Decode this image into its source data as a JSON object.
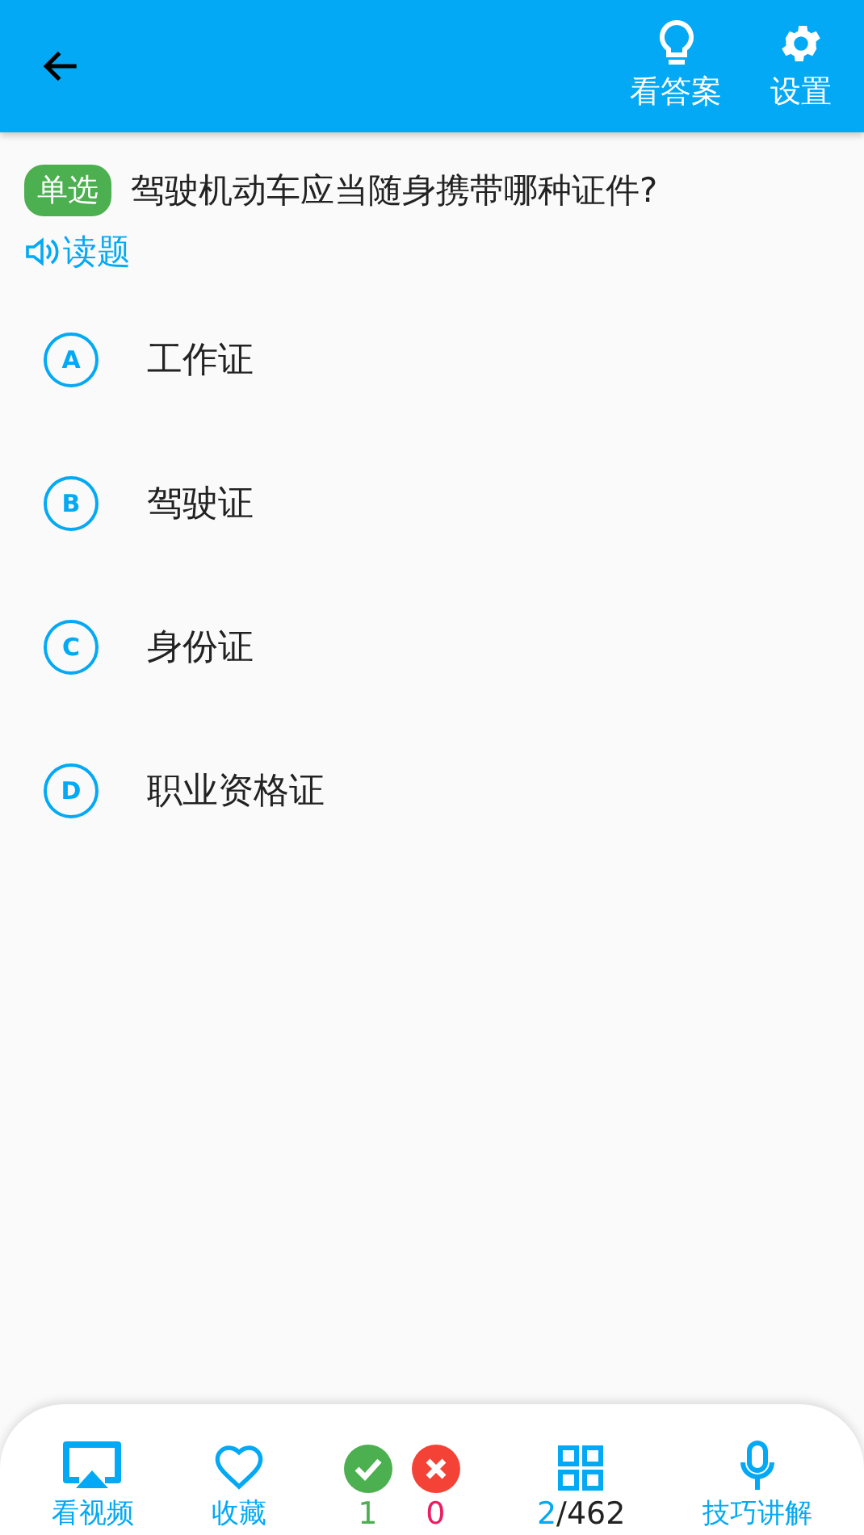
{
  "header": {
    "actions": [
      {
        "kind": "answer",
        "label": "看答案"
      },
      {
        "kind": "settings",
        "label": "设置"
      }
    ]
  },
  "question": {
    "type_badge": "单选",
    "text": "驾驶机动车应当随身携带哪种证件?",
    "read_label": "读题"
  },
  "options": [
    {
      "letter": "A",
      "text": "工作证"
    },
    {
      "letter": "B",
      "text": "驾驶证"
    },
    {
      "letter": "C",
      "text": "身份证"
    },
    {
      "letter": "D",
      "text": "职业资格证"
    }
  ],
  "bottom_bar": {
    "video": "看视频",
    "favorite": "收藏",
    "correct_count": "1",
    "wrong_count": "0",
    "current": "2",
    "total": "/462",
    "tips": "技巧讲解"
  }
}
